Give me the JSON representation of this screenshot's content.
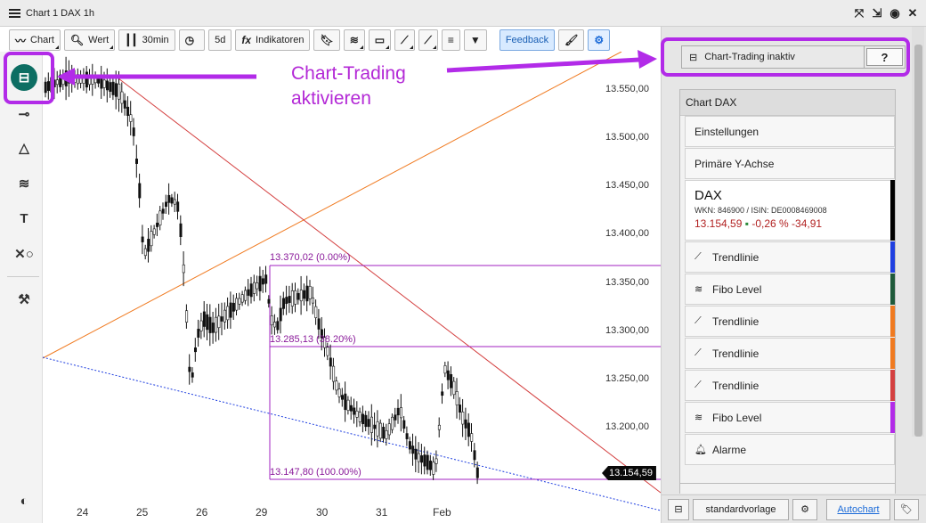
{
  "window": {
    "title": "Chart 1 DAX 1h",
    "icons": [
      "expand-icon",
      "detach-icon",
      "target-icon",
      "close-icon"
    ]
  },
  "toolbar": {
    "chart_label": "Chart",
    "search_label": "Wert",
    "interval_label": "30min",
    "range_label": "5d",
    "indicators_label": "Indikatoren",
    "feedback_label": "Feedback"
  },
  "left_tools": [
    "chart-trading-icon",
    "line-tool-icon",
    "triangle-tool-icon",
    "fibo-tool-icon",
    "text-tool-icon",
    "shapes-tool-icon",
    "tools-icon",
    "contrast-icon"
  ],
  "annotations": {
    "line1": "Chart-Trading",
    "line2": "aktivieren"
  },
  "chart": {
    "price_labels": [
      "13.550,00",
      "13.500,00",
      "13.450,00",
      "13.400,00",
      "13.350,00",
      "13.300,00",
      "13.250,00",
      "13.200,00"
    ],
    "x_labels": [
      "24",
      "25",
      "26",
      "29",
      "30",
      "31",
      "Feb"
    ],
    "fib_labels": [
      "13.370,02 (0.00%)",
      "13.285,13 (38.20%)",
      "13.147,80 (100.00%)"
    ],
    "current_price": "13.154,59"
  },
  "panel": {
    "chart_trading_label": "Chart-Trading inaktiv",
    "help_label": "?",
    "header": "Chart DAX",
    "settings": "Einstellungen",
    "y_axis": "Primäre Y-Achse",
    "instrument": {
      "name": "DAX",
      "ids": "WKN: 846900 / ISIN: DE0008469008",
      "quote": "13.154,59",
      "change_pct": "-0,26 %",
      "change_abs": "-34,91"
    },
    "items": [
      {
        "label": "Trendlinie",
        "color": "#1f3fe0"
      },
      {
        "label": "Fibo Level",
        "color": "#1f5a3a"
      },
      {
        "label": "Trendlinie",
        "color": "#f07a20"
      },
      {
        "label": "Trendlinie",
        "color": "#f07a20"
      },
      {
        "label": "Trendlinie",
        "color": "#d44040"
      },
      {
        "label": "Fibo Level",
        "color": "#b22be8"
      }
    ],
    "alarms": "Alarme",
    "template_label": "standardvorlage",
    "autochart_label": "Autochart"
  }
}
